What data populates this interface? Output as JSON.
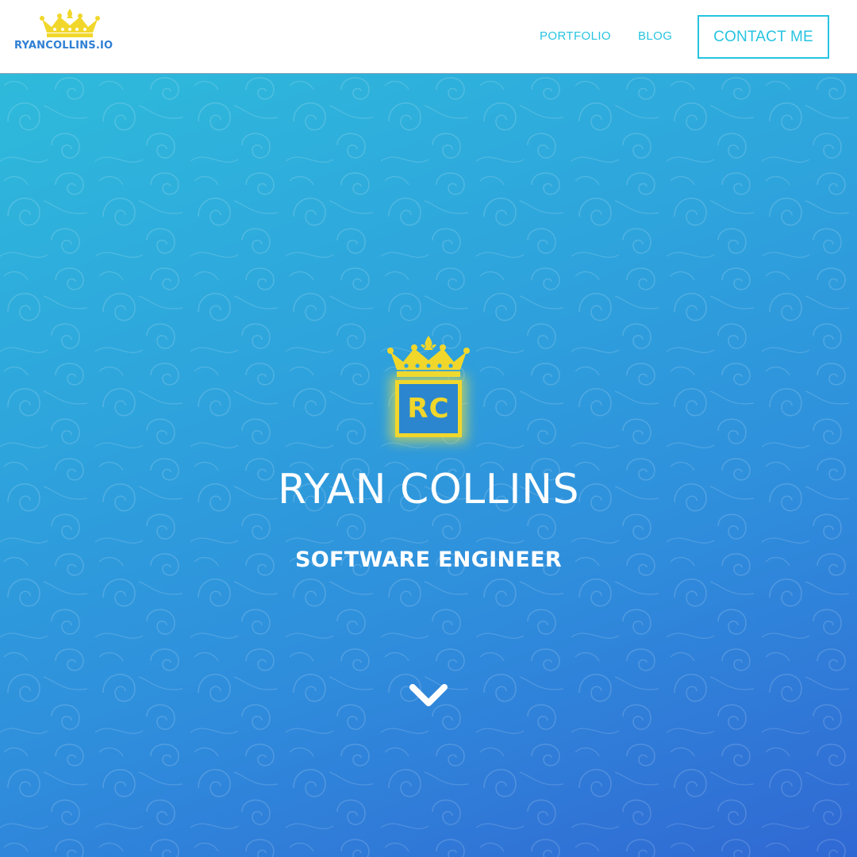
{
  "header": {
    "brand_text": "RYANCOLLINS.IO",
    "brand_icon": "crown-icon",
    "nav": {
      "portfolio_label": "PORTFOLIO",
      "blog_label": "BLOG",
      "contact_label": "CONTACT ME"
    }
  },
  "hero": {
    "logo_icon": "crown-icon",
    "badge_text": "RC",
    "title": "RYAN COLLINS",
    "subtitle": "SOFTWARE ENGINEER",
    "scroll_icon": "chevron-down-icon"
  },
  "colors": {
    "accent": "#27c4e0",
    "brand_blue": "#2f7fd3",
    "gold": "#f1d72b",
    "hero_gradient_start": "#2ebadb",
    "hero_gradient_end": "#3068d3"
  }
}
